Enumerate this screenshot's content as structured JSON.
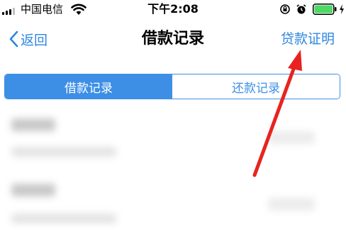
{
  "status_bar": {
    "carrier": "中国电信",
    "time": "下午2:08",
    "icons": [
      "signal-icon",
      "wifi-icon",
      "orientation-lock-icon",
      "alarm-icon",
      "battery-icon",
      "charging-icon"
    ]
  },
  "nav": {
    "back_label": "返回",
    "title": "借款记录",
    "right_label": "贷款证明"
  },
  "tabs": [
    {
      "label": "借款记录",
      "active": true
    },
    {
      "label": "还款记录",
      "active": false
    }
  ],
  "colors": {
    "accent": "#3d8fe6",
    "link": "#2f86e0",
    "battery": "#4cd964",
    "annotation": "#e8231f"
  },
  "list": {
    "items_visible": 2,
    "content": "blurred"
  }
}
